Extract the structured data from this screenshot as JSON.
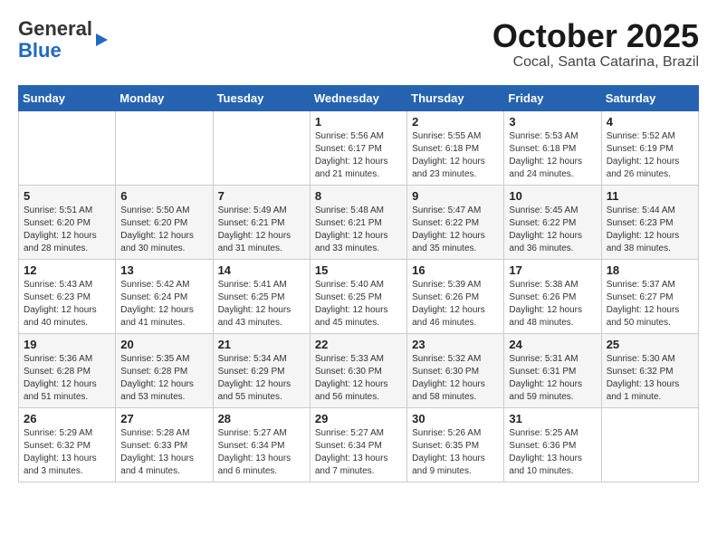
{
  "logo": {
    "general": "General",
    "blue": "Blue"
  },
  "title": "October 2025",
  "location": "Cocal, Santa Catarina, Brazil",
  "weekdays": [
    "Sunday",
    "Monday",
    "Tuesday",
    "Wednesday",
    "Thursday",
    "Friday",
    "Saturday"
  ],
  "weeks": [
    [
      {
        "day": "",
        "info": ""
      },
      {
        "day": "",
        "info": ""
      },
      {
        "day": "",
        "info": ""
      },
      {
        "day": "1",
        "info": "Sunrise: 5:56 AM\nSunset: 6:17 PM\nDaylight: 12 hours\nand 21 minutes."
      },
      {
        "day": "2",
        "info": "Sunrise: 5:55 AM\nSunset: 6:18 PM\nDaylight: 12 hours\nand 23 minutes."
      },
      {
        "day": "3",
        "info": "Sunrise: 5:53 AM\nSunset: 6:18 PM\nDaylight: 12 hours\nand 24 minutes."
      },
      {
        "day": "4",
        "info": "Sunrise: 5:52 AM\nSunset: 6:19 PM\nDaylight: 12 hours\nand 26 minutes."
      }
    ],
    [
      {
        "day": "5",
        "info": "Sunrise: 5:51 AM\nSunset: 6:20 PM\nDaylight: 12 hours\nand 28 minutes."
      },
      {
        "day": "6",
        "info": "Sunrise: 5:50 AM\nSunset: 6:20 PM\nDaylight: 12 hours\nand 30 minutes."
      },
      {
        "day": "7",
        "info": "Sunrise: 5:49 AM\nSunset: 6:21 PM\nDaylight: 12 hours\nand 31 minutes."
      },
      {
        "day": "8",
        "info": "Sunrise: 5:48 AM\nSunset: 6:21 PM\nDaylight: 12 hours\nand 33 minutes."
      },
      {
        "day": "9",
        "info": "Sunrise: 5:47 AM\nSunset: 6:22 PM\nDaylight: 12 hours\nand 35 minutes."
      },
      {
        "day": "10",
        "info": "Sunrise: 5:45 AM\nSunset: 6:22 PM\nDaylight: 12 hours\nand 36 minutes."
      },
      {
        "day": "11",
        "info": "Sunrise: 5:44 AM\nSunset: 6:23 PM\nDaylight: 12 hours\nand 38 minutes."
      }
    ],
    [
      {
        "day": "12",
        "info": "Sunrise: 5:43 AM\nSunset: 6:23 PM\nDaylight: 12 hours\nand 40 minutes."
      },
      {
        "day": "13",
        "info": "Sunrise: 5:42 AM\nSunset: 6:24 PM\nDaylight: 12 hours\nand 41 minutes."
      },
      {
        "day": "14",
        "info": "Sunrise: 5:41 AM\nSunset: 6:25 PM\nDaylight: 12 hours\nand 43 minutes."
      },
      {
        "day": "15",
        "info": "Sunrise: 5:40 AM\nSunset: 6:25 PM\nDaylight: 12 hours\nand 45 minutes."
      },
      {
        "day": "16",
        "info": "Sunrise: 5:39 AM\nSunset: 6:26 PM\nDaylight: 12 hours\nand 46 minutes."
      },
      {
        "day": "17",
        "info": "Sunrise: 5:38 AM\nSunset: 6:26 PM\nDaylight: 12 hours\nand 48 minutes."
      },
      {
        "day": "18",
        "info": "Sunrise: 5:37 AM\nSunset: 6:27 PM\nDaylight: 12 hours\nand 50 minutes."
      }
    ],
    [
      {
        "day": "19",
        "info": "Sunrise: 5:36 AM\nSunset: 6:28 PM\nDaylight: 12 hours\nand 51 minutes."
      },
      {
        "day": "20",
        "info": "Sunrise: 5:35 AM\nSunset: 6:28 PM\nDaylight: 12 hours\nand 53 minutes."
      },
      {
        "day": "21",
        "info": "Sunrise: 5:34 AM\nSunset: 6:29 PM\nDaylight: 12 hours\nand 55 minutes."
      },
      {
        "day": "22",
        "info": "Sunrise: 5:33 AM\nSunset: 6:30 PM\nDaylight: 12 hours\nand 56 minutes."
      },
      {
        "day": "23",
        "info": "Sunrise: 5:32 AM\nSunset: 6:30 PM\nDaylight: 12 hours\nand 58 minutes."
      },
      {
        "day": "24",
        "info": "Sunrise: 5:31 AM\nSunset: 6:31 PM\nDaylight: 12 hours\nand 59 minutes."
      },
      {
        "day": "25",
        "info": "Sunrise: 5:30 AM\nSunset: 6:32 PM\nDaylight: 13 hours\nand 1 minute."
      }
    ],
    [
      {
        "day": "26",
        "info": "Sunrise: 5:29 AM\nSunset: 6:32 PM\nDaylight: 13 hours\nand 3 minutes."
      },
      {
        "day": "27",
        "info": "Sunrise: 5:28 AM\nSunset: 6:33 PM\nDaylight: 13 hours\nand 4 minutes."
      },
      {
        "day": "28",
        "info": "Sunrise: 5:27 AM\nSunset: 6:34 PM\nDaylight: 13 hours\nand 6 minutes."
      },
      {
        "day": "29",
        "info": "Sunrise: 5:27 AM\nSunset: 6:34 PM\nDaylight: 13 hours\nand 7 minutes."
      },
      {
        "day": "30",
        "info": "Sunrise: 5:26 AM\nSunset: 6:35 PM\nDaylight: 13 hours\nand 9 minutes."
      },
      {
        "day": "31",
        "info": "Sunrise: 5:25 AM\nSunset: 6:36 PM\nDaylight: 13 hours\nand 10 minutes."
      },
      {
        "day": "",
        "info": ""
      }
    ]
  ]
}
